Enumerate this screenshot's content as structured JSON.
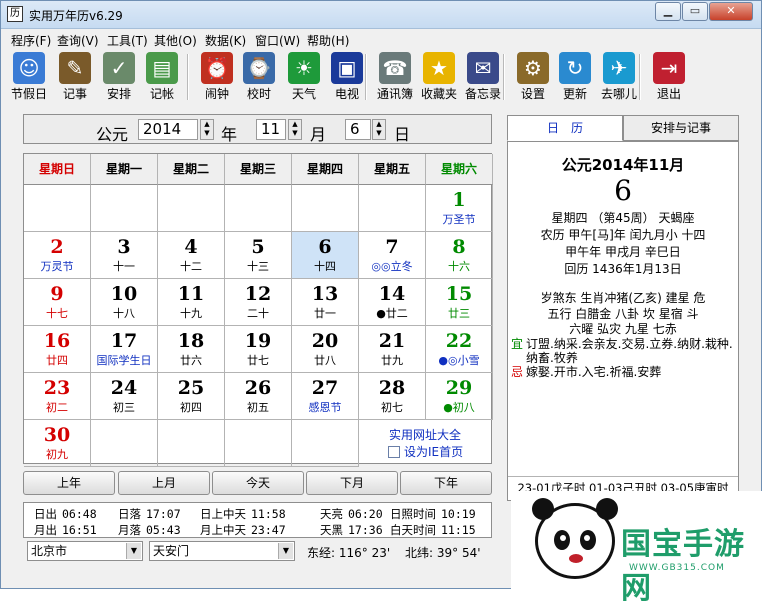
{
  "window": {
    "title": "实用万年历v6.29",
    "app_icon_glyph": "历"
  },
  "menu": [
    "程序(F)",
    "查询(V)",
    "工具(T)",
    "其他(O)",
    "数据(K)",
    "窗口(W)",
    "帮助(H)"
  ],
  "toolbar": [
    {
      "label": "节假日",
      "icon": "holiday-icon",
      "color": "#3a7bd5",
      "glyph": "☺"
    },
    {
      "label": "记事",
      "icon": "notes-icon",
      "color": "#7a5a2a",
      "glyph": "✎"
    },
    {
      "label": "安排",
      "icon": "schedule-icon",
      "color": "#6a8a6a",
      "glyph": "✓"
    },
    {
      "label": "记帐",
      "icon": "ledger-icon",
      "color": "#4a9a4a",
      "glyph": "▤"
    },
    {
      "label": "闹钟",
      "icon": "alarm-clock-icon",
      "color": "#c03020",
      "glyph": "⏰"
    },
    {
      "label": "校时",
      "icon": "time-sync-icon",
      "color": "#3a6aa8",
      "glyph": "⌚"
    },
    {
      "label": "天气",
      "icon": "weather-icon",
      "color": "#1e9a3a",
      "glyph": "☀"
    },
    {
      "label": "电视",
      "icon": "tv-icon",
      "color": "#1a3a9a",
      "glyph": "▣"
    },
    {
      "label": "通讯簿",
      "icon": "address-book-icon",
      "color": "#6a7a7a",
      "glyph": "☎"
    },
    {
      "label": "收藏夹",
      "icon": "favorites-star-icon",
      "color": "#e8b400",
      "glyph": "★"
    },
    {
      "label": "备忘录",
      "icon": "memo-icon",
      "color": "#3a4a8a",
      "glyph": "✉"
    },
    {
      "label": "设置",
      "icon": "settings-icon",
      "color": "#8a6a2a",
      "glyph": "⚙"
    },
    {
      "label": "更新",
      "icon": "update-icon",
      "color": "#2a8ad0",
      "glyph": "↻"
    },
    {
      "label": "去哪儿",
      "icon": "qunar-camel-icon",
      "color": "#1a9ad0",
      "glyph": "✈"
    },
    {
      "label": "退出",
      "icon": "exit-door-icon",
      "color": "#c02030",
      "glyph": "⇥"
    }
  ],
  "date_selector": {
    "era_label": "公元",
    "year": "2014",
    "year_unit": "年",
    "month": "11",
    "month_unit": "月",
    "day": "6",
    "day_unit": "日"
  },
  "weekdays": [
    "星期日",
    "星期一",
    "星期二",
    "星期三",
    "星期四",
    "星期五",
    "星期六"
  ],
  "calendar_weeks": [
    [
      null,
      null,
      null,
      null,
      null,
      null,
      {
        "day": "1",
        "sub": "万圣节",
        "sub_color": "blue"
      }
    ],
    [
      {
        "day": "2",
        "sub": "万灵节",
        "sub_color": "blue"
      },
      {
        "day": "3",
        "sub": "十一"
      },
      {
        "day": "4",
        "sub": "十二"
      },
      {
        "day": "5",
        "sub": "十三"
      },
      {
        "day": "6",
        "sub": "十四",
        "today": true
      },
      {
        "day": "7",
        "sub": "◎◎立冬",
        "sub_color": "blue"
      },
      {
        "day": "8",
        "sub": "十六"
      }
    ],
    [
      {
        "day": "9",
        "sub": "十七"
      },
      {
        "day": "10",
        "sub": "十八"
      },
      {
        "day": "11",
        "sub": "十九"
      },
      {
        "day": "12",
        "sub": "二十"
      },
      {
        "day": "13",
        "sub": "廿一"
      },
      {
        "day": "14",
        "sub": "●廿二"
      },
      {
        "day": "15",
        "sub": "廿三"
      }
    ],
    [
      {
        "day": "16",
        "sub": "廿四"
      },
      {
        "day": "17",
        "sub": "国际学生日",
        "sub_color": "blue"
      },
      {
        "day": "18",
        "sub": "廿六"
      },
      {
        "day": "19",
        "sub": "廿七"
      },
      {
        "day": "20",
        "sub": "廿八"
      },
      {
        "day": "21",
        "sub": "廿九"
      },
      {
        "day": "22",
        "sub": "●◎小雪",
        "sub_color": "blue"
      }
    ],
    [
      {
        "day": "23",
        "sub": "初二"
      },
      {
        "day": "24",
        "sub": "初三"
      },
      {
        "day": "25",
        "sub": "初四"
      },
      {
        "day": "26",
        "sub": "初五"
      },
      {
        "day": "27",
        "sub": "感恩节",
        "sub_color": "blue"
      },
      {
        "day": "28",
        "sub": "初七"
      },
      {
        "day": "29",
        "sub": "●初八"
      }
    ],
    [
      {
        "day": "30",
        "sub": "初九"
      },
      null,
      null,
      null,
      null,
      null,
      null
    ]
  ],
  "links": {
    "site_link": "实用网址大全",
    "set_homepage": "设为IE首页"
  },
  "nav_buttons": [
    "上年",
    "上月",
    "今天",
    "下月",
    "下年"
  ],
  "sun_moon": [
    {
      "label": "日出",
      "value": "06:48"
    },
    {
      "label": "日落",
      "value": "17:07"
    },
    {
      "label": "日上中天",
      "value": "11:58"
    },
    {
      "label": "天亮",
      "value": "06:20"
    },
    {
      "label": "日照时间",
      "value": "10:19"
    },
    {
      "label": "月出",
      "value": "16:51"
    },
    {
      "label": "月落",
      "value": "05:43"
    },
    {
      "label": "月上中天",
      "value": "23:47"
    },
    {
      "label": "天黑",
      "value": "17:36"
    },
    {
      "label": "白天时间",
      "value": "11:15"
    }
  ],
  "location": {
    "city": "北京市",
    "place": "天安门",
    "longitude": "东经: 116° 23'",
    "latitude": "北纬: 39° 54'"
  },
  "tabs": [
    "日　历",
    "安排与记事"
  ],
  "detail": {
    "heading": "公元2014年11月",
    "big_day": "6",
    "line1": "星期四 （第45周） 天蝎座",
    "line2": "农历 甲午[马]年 闰九月小 十四",
    "line3": "甲午年 甲戌月 辛巳日",
    "line4": "回历 1436年1月13日",
    "line5": "岁煞东 生肖冲猪(乙亥) 建星 危",
    "line6": "五行 白腊金 八卦 坎 星宿 斗",
    "line7": "六曜 弘灾 九星 七赤",
    "yi_label": "宜",
    "yi_text": "订盟.纳采.会亲友.交易.立券.纳财.栽种.纳畜.牧养",
    "ji_label": "忌",
    "ji_text": "嫁娶.开市.入宅.祈福.安葬",
    "hours": "23-01戊子时 01-03己丑时 03-05庚寅时"
  },
  "watermark": {
    "title": "国宝手游网",
    "url": "WWW.GB315.COM"
  }
}
